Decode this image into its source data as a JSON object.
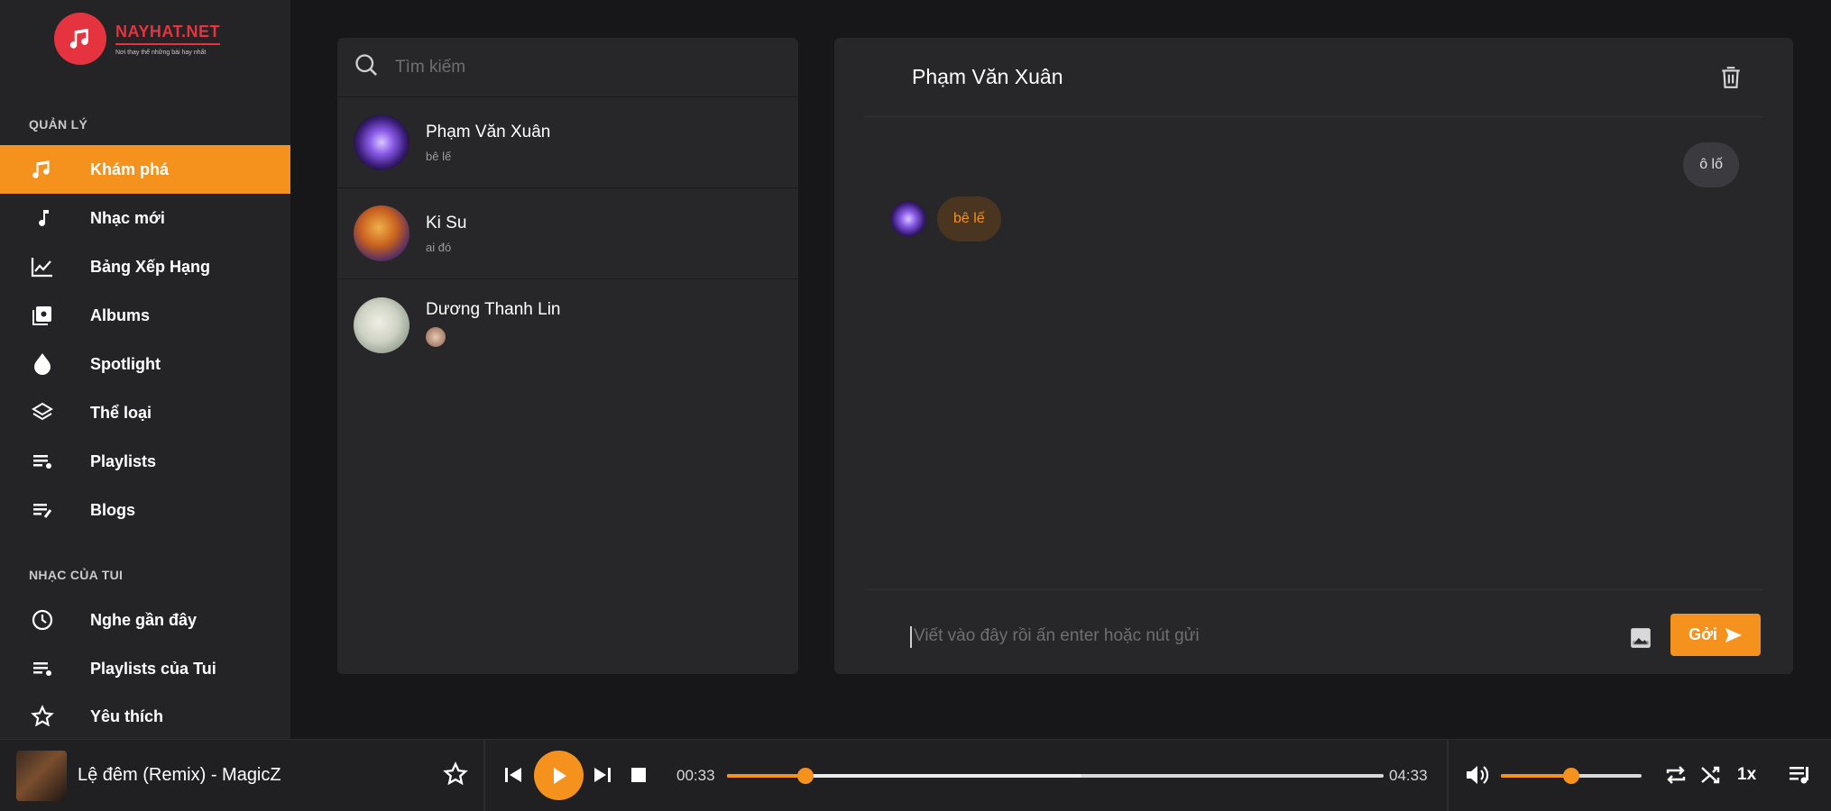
{
  "brand": {
    "name": "NAYHAT.NET",
    "slogan": "Nơi thay thế những bài hay nhất",
    "accent": "#f5921d",
    "logo_color": "#e5343f"
  },
  "sidebar": {
    "section_manage": "QUẢN LÝ",
    "section_mine": "NHẠC CỦA TUI",
    "items": [
      {
        "label": "Khám phá",
        "icon": "music-note-icon",
        "active": true
      },
      {
        "label": "Nhạc mới",
        "icon": "music-note-icon"
      },
      {
        "label": "Bảng Xếp Hạng",
        "icon": "chart-icon"
      },
      {
        "label": "Albums",
        "icon": "album-icon"
      },
      {
        "label": "Spotlight",
        "icon": "drop-icon"
      },
      {
        "label": "Thể loại",
        "icon": "layers-icon"
      },
      {
        "label": "Playlists",
        "icon": "playlist-icon"
      },
      {
        "label": "Blogs",
        "icon": "blog-icon"
      }
    ],
    "my_items": [
      {
        "label": "Nghe gần đây",
        "icon": "clock-icon"
      },
      {
        "label": "Playlists của Tui",
        "icon": "playlist-icon"
      },
      {
        "label": "Yêu thích",
        "icon": "star-icon"
      }
    ]
  },
  "conversations": {
    "search_placeholder": "Tìm kiếm",
    "items": [
      {
        "name": "Phạm Văn Xuân",
        "last": "bê lế"
      },
      {
        "name": "Ki Su",
        "last": "ai đó"
      },
      {
        "name": "Dương Thanh Lin",
        "last": ""
      }
    ]
  },
  "chat": {
    "title": "Phạm Văn Xuân",
    "messages": [
      {
        "from": "me",
        "text": "ô lố"
      },
      {
        "from": "them",
        "text": "bê lế"
      }
    ],
    "composer_placeholder": "Viết vào đây rồi ấn enter hoặc nút gửi",
    "send_label": "Gởi"
  },
  "player": {
    "track": "Lệ đêm (Remix) - MagicZ",
    "current_time": "00:33",
    "duration": "04:33",
    "progress": 0.12,
    "buffered": 0.54,
    "volume": 0.5,
    "speed": "1x"
  }
}
